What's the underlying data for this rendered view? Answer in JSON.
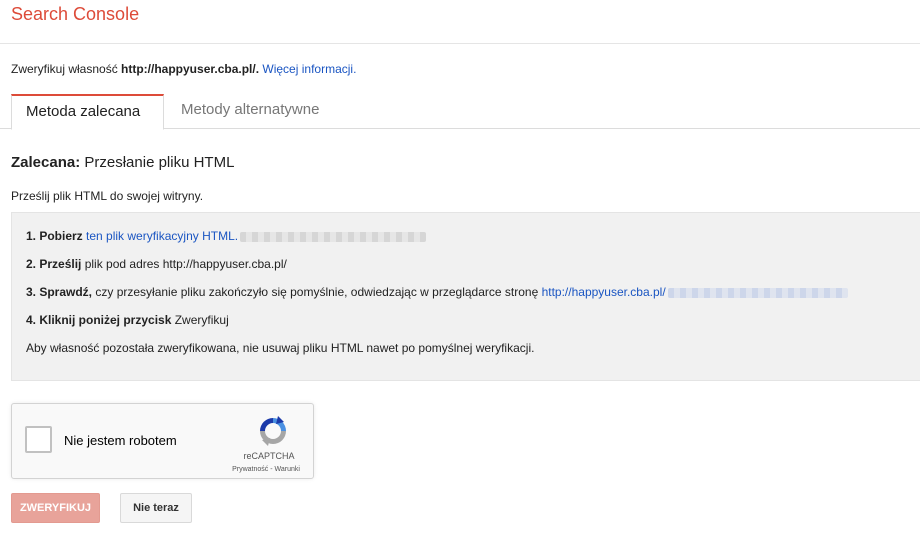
{
  "app": {
    "title": "Search Console"
  },
  "verify": {
    "prefix": "Zweryfikuj własność ",
    "property": "http://happyuser.cba.pl/",
    "suffix": ". ",
    "more_link": "Więcej informacji."
  },
  "tabs": [
    {
      "label": "Metoda zalecana",
      "active": true
    },
    {
      "label": "Metody alternatywne",
      "active": false
    }
  ],
  "method": {
    "heading_bold": "Zalecana:",
    "heading_rest": " Przesłanie pliku HTML",
    "description": "Prześlij plik HTML do swojej witryny."
  },
  "steps": {
    "s1_bold": "1. Pobierz",
    "s1_link": "ten plik weryfikacyjny HTML.",
    "s2_bold": "2. Prześlij",
    "s2_text": " plik pod adres http://happyuser.cba.pl/",
    "s3_bold": "3. Sprawdź,",
    "s3_text": " czy przesyłanie pliku zakończyło się pomyślnie, odwiedzając w przeglądarce stronę ",
    "s3_link": "http://happyuser.cba.pl/",
    "s4_bold": "4. Kliknij poniżej przycisk",
    "s4_text": " Zweryfikuj",
    "note": "Aby własność pozostała zweryfikowana, nie usuwaj pliku HTML nawet po pomyślnej weryfikacji."
  },
  "captcha": {
    "label": "Nie jestem robotem",
    "brand": "reCAPTCHA",
    "links": "Prywatność - Warunki",
    "checked": false
  },
  "buttons": {
    "verify": "ZWERYFIKUJ",
    "later": "Nie teraz"
  },
  "colors": {
    "brand_red": "#dd4b39",
    "link_blue": "#1a55c2",
    "verify_button_disabled": "#e8a39a"
  }
}
